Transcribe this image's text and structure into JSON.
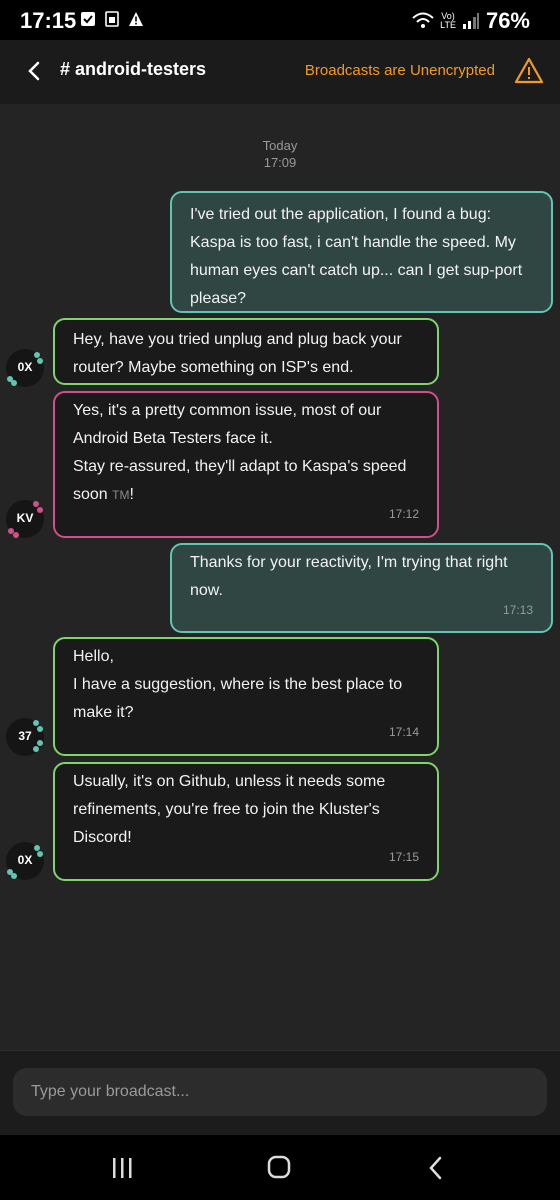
{
  "status_bar": {
    "time": "17:15",
    "battery": "76%",
    "network_top": "Vo)",
    "network_bottom": "LTE",
    "icons": [
      "checkbox-icon",
      "sim-icon",
      "warning-icon",
      "wifi-icon",
      "signal-icon"
    ]
  },
  "header": {
    "channel": "# android-testers",
    "encryption_notice": "Broadcasts are Unencrypted",
    "accent_color": "#f39a20"
  },
  "date_separator": {
    "day": "Today",
    "time": "17:09"
  },
  "messages": [
    {
      "direction": "outgoing",
      "text": "I've tried out the application, I found a bug: Kaspa is too fast, i can't handle the speed. My human eyes can't catch up... can I get sup-port please?",
      "time": ""
    },
    {
      "direction": "incoming",
      "avatar": "0X",
      "text": "Hey, have you tried unplug and plug back your router? Maybe something on ISP's end.",
      "time": ""
    },
    {
      "direction": "incoming",
      "avatar": "KV",
      "text_lines": [
        "Yes, it's a pretty common issue, most of our Android Beta Testers face it.",
        "Stay re-assured, they'll adapt to Kaspa's speed soon"
      ],
      "tm": "TM",
      "tail": "!",
      "time": "17:12"
    },
    {
      "direction": "outgoing",
      "text": "Thanks for your reactivity, I'm trying that right now.",
      "time": "17:13"
    },
    {
      "direction": "incoming",
      "avatar": "37",
      "text_lines": [
        "Hello,",
        "I have a suggestion, where is the best place to make it?"
      ],
      "time": "17:14"
    },
    {
      "direction": "incoming",
      "avatar": "0X",
      "text": "Usually, it's on Github, unless it needs some refinements, you're free to join the Kluster's Discord!",
      "time": "17:15"
    }
  ],
  "composer": {
    "placeholder": "Type your broadcast..."
  },
  "colors": {
    "outgoing_border": "#62c4b2",
    "incoming_green_border": "#7fd46a",
    "incoming_pink_border": "#d24f8a"
  }
}
